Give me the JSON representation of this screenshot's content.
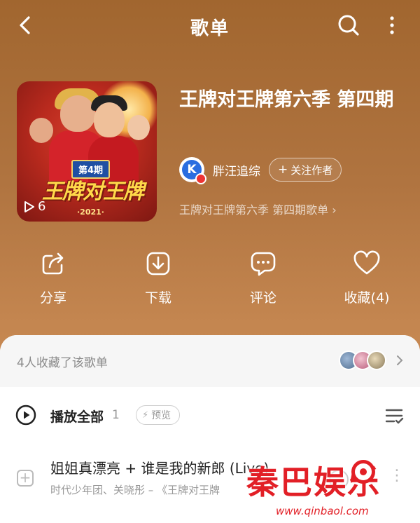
{
  "header": {
    "title": "歌单"
  },
  "playlist": {
    "title": "王牌对王牌第六季  第四期",
    "play_count": "6",
    "cover": {
      "badge": "第4期",
      "logo_text": "王牌对王牌",
      "year": "·2021·"
    },
    "creator": {
      "name": "胖汪追综",
      "avatar_letter": "K",
      "follow_label": "关注作者"
    },
    "description": "王牌对王牌第六季 第四期歌单",
    "description_chevron": "›"
  },
  "actions": [
    {
      "label": "分享",
      "icon": "share-icon"
    },
    {
      "label": "下载",
      "icon": "download-icon"
    },
    {
      "label": "评论",
      "icon": "comment-icon"
    },
    {
      "label": "收藏(4)",
      "icon": "heart-icon"
    }
  ],
  "favorites": {
    "text": "4人收藏了该歌单"
  },
  "play_all": {
    "label": "播放全部",
    "count": "1",
    "preview_label": "预览"
  },
  "songs": [
    {
      "title": "姐姐真漂亮 + 谁是我的新郎 (Live)",
      "subtitle": "时代少年团、关晓彤 – 《王牌对王牌"
    }
  ],
  "watermark": {
    "logo": "秦巴娱乐",
    "url": "www.qinbaol.com"
  },
  "colors": {
    "background_top": "#a1662f",
    "background_bottom": "#d3925a",
    "accent_red": "#e21f26",
    "creator_blue": "#2a6de0"
  }
}
